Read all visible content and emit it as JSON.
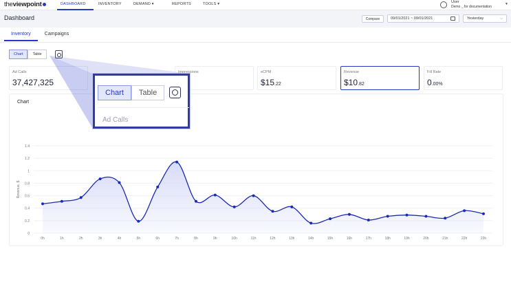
{
  "logo": {
    "part1": "the",
    "part2": "viewpoint"
  },
  "nav": {
    "items": [
      {
        "label": "DASHBOARD",
        "active": true
      },
      {
        "label": "INVENTORY",
        "active": false
      },
      {
        "label": "DEMAND ▾",
        "active": false
      },
      {
        "label": "REPORTS",
        "active": false
      },
      {
        "label": "TOOLS ▾",
        "active": false
      }
    ]
  },
  "user": {
    "name": "User",
    "org": "Demo _ for documentation",
    "icon": "avatar-icon"
  },
  "header": {
    "title": "Dashboard",
    "compare_label": "Compare",
    "date_range": "09/01/2021  ~  09/01/2021",
    "preset": "Yesterday"
  },
  "tabs": [
    {
      "label": "Inventory",
      "active": true
    },
    {
      "label": "Campaigns",
      "active": false
    }
  ],
  "view_toggle": {
    "chart_label": "Chart",
    "table_label": "Table",
    "selected": "Chart"
  },
  "kpis": [
    {
      "label": "Ad Calls",
      "value": "37,427,325",
      "selected": false
    },
    {
      "label": "Impressions",
      "value": "",
      "selected": false
    },
    {
      "label": "eCPM",
      "value_main": "$15",
      "value_dec": ".22",
      "selected": false
    },
    {
      "label": "Revenue",
      "value_main": "$10",
      "value_dec": ".82",
      "selected": true
    },
    {
      "label": "Fill Rate",
      "value_main": "0",
      "value_dec": ".00%",
      "selected": false
    }
  ],
  "chart_card": {
    "title": "Chart"
  },
  "zoom": {
    "chart_label": "Chart",
    "table_label": "Table",
    "field_label": "Ad Calls"
  },
  "colors": {
    "accent": "#2437c8",
    "line": "#1a2bb3",
    "fill": "#d6daf7"
  },
  "chart_data": {
    "type": "area",
    "title": "",
    "xlabel": "",
    "ylabel": "Revenue, $",
    "ylim": [
      0,
      1.4
    ],
    "yticks": [
      "0",
      "0.2",
      "0.4",
      "0.6",
      "0.8",
      "1",
      "1.2",
      "1.4"
    ],
    "x": [
      "0h",
      "1h",
      "2h",
      "3h",
      "4h",
      "5h",
      "6h",
      "7h",
      "8h",
      "9h",
      "10h",
      "11h",
      "12h",
      "13h",
      "14h",
      "15h",
      "16h",
      "17h",
      "18h",
      "19h",
      "20h",
      "21h",
      "22h",
      "23h"
    ],
    "series": [
      {
        "values": [
          0.47,
          0.51,
          0.57,
          0.87,
          0.81,
          0.19,
          0.74,
          1.14,
          0.51,
          0.61,
          0.42,
          0.6,
          0.35,
          0.42,
          0.16,
          0.23,
          0.3,
          0.21,
          0.27,
          0.29,
          0.27,
          0.24,
          0.36,
          0.31
        ]
      }
    ]
  }
}
